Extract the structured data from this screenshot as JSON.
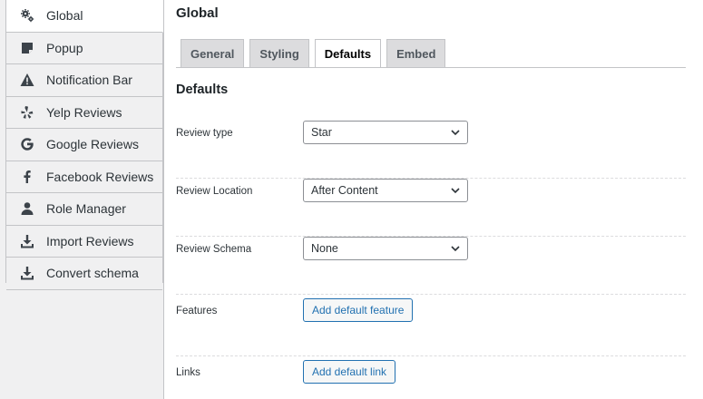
{
  "sidebar": {
    "items": [
      {
        "label": "Global",
        "icon": "gears-icon"
      },
      {
        "label": "Popup",
        "icon": "sticky-note-icon"
      },
      {
        "label": "Notification Bar",
        "icon": "warning-icon"
      },
      {
        "label": "Yelp Reviews",
        "icon": "yelp-icon"
      },
      {
        "label": "Google Reviews",
        "icon": "google-icon"
      },
      {
        "label": "Facebook Reviews",
        "icon": "facebook-icon"
      },
      {
        "label": "Role Manager",
        "icon": "user-icon"
      },
      {
        "label": "Import Reviews",
        "icon": "download-icon"
      },
      {
        "label": "Convert schema",
        "icon": "download-icon"
      }
    ],
    "active": "Global"
  },
  "main": {
    "title": "Global",
    "tabs": [
      {
        "label": "General"
      },
      {
        "label": "Styling"
      },
      {
        "label": "Defaults"
      },
      {
        "label": "Embed"
      }
    ],
    "active_tab": "Defaults",
    "section_title": "Defaults",
    "fields": {
      "review_type": {
        "label": "Review type",
        "value": "Star"
      },
      "review_location": {
        "label": "Review Location",
        "value": "After Content"
      },
      "review_schema": {
        "label": "Review Schema",
        "value": "None"
      },
      "features": {
        "label": "Features",
        "button": "Add default feature"
      },
      "links": {
        "label": "Links",
        "button": "Add default link"
      }
    }
  },
  "colors": {
    "accent": "#2271b1",
    "border": "#c3c4c7",
    "sidebar_bg": "#f0f0f1"
  }
}
